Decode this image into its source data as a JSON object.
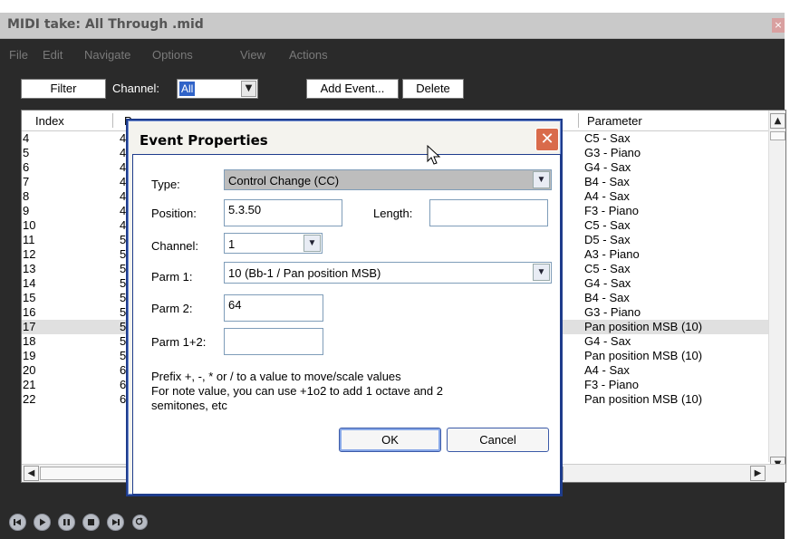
{
  "window": {
    "title": "MIDI take: All Through .mid",
    "close_glyph": "×"
  },
  "menu": [
    "File",
    "Edit",
    "Navigate",
    "Options",
    "View",
    "Actions"
  ],
  "toolbar": {
    "filter_label": "Filter",
    "channel_label": "Channel:",
    "channel_value": "All",
    "add_event_label": "Add Event...",
    "delete_label": "Delete"
  },
  "list": {
    "columns": {
      "index": "Index",
      "position_partial": "P",
      "parameter": "Parameter"
    },
    "rows": [
      {
        "index": "4",
        "pos": "4",
        "param": "C5 - Sax"
      },
      {
        "index": "5",
        "pos": "4",
        "param": "G3 - Piano"
      },
      {
        "index": "6",
        "pos": "4",
        "param": "G4 - Sax"
      },
      {
        "index": "7",
        "pos": "4",
        "param": "B4 - Sax"
      },
      {
        "index": "8",
        "pos": "4",
        "param": "A4 - Sax"
      },
      {
        "index": "9",
        "pos": "4",
        "param": "F3 - Piano"
      },
      {
        "index": "10",
        "pos": "4",
        "param": "C5 - Sax"
      },
      {
        "index": "11",
        "pos": "5",
        "param": "D5 - Sax"
      },
      {
        "index": "12",
        "pos": "5",
        "param": "A3 - Piano"
      },
      {
        "index": "13",
        "pos": "5",
        "param": "C5 - Sax"
      },
      {
        "index": "14",
        "pos": "5",
        "param": "G4 - Sax"
      },
      {
        "index": "15",
        "pos": "5",
        "param": "B4 - Sax"
      },
      {
        "index": "16",
        "pos": "5",
        "param": "G3 - Piano"
      },
      {
        "index": "17",
        "pos": "5",
        "param": "Pan position MSB (10)"
      },
      {
        "index": "18",
        "pos": "5",
        "param": "G4 - Sax"
      },
      {
        "index": "19",
        "pos": "5",
        "param": "Pan position MSB (10)"
      },
      {
        "index": "20",
        "pos": "6",
        "param": "A4 - Sax"
      },
      {
        "index": "21",
        "pos": "6",
        "param": "F3 - Piano"
      },
      {
        "index": "22",
        "pos": "6",
        "param": "Pan position MSB (10)"
      }
    ],
    "selected_index": "17"
  },
  "dialog": {
    "title": "Event Properties",
    "close_glyph": "✕",
    "type_label": "Type:",
    "type_value": "Control Change (CC)",
    "position_label": "Position:",
    "position_value": "5.3.50",
    "length_label": "Length:",
    "length_value": "",
    "channel_label": "Channel:",
    "channel_value": "1",
    "parm1_label": "Parm 1:",
    "parm1_value": "10 (Bb-1 / Pan position MSB)",
    "parm2_label": "Parm 2:",
    "parm2_value": "64",
    "parm12_label": "Parm 1+2:",
    "parm12_value": "",
    "hint_line1": "Prefix +, -, * or / to a value to move/scale values",
    "hint_line2": "For note value, you can use +1o2 to add 1 octave and 2",
    "hint_line3": "semitones, etc",
    "ok_label": "OK",
    "cancel_label": "Cancel"
  },
  "icons": {
    "dropdown": "chevron-down-icon",
    "scroll_up": "arrow-up-icon",
    "scroll_left": "arrow-left-icon",
    "scroll_right": "arrow-right-icon",
    "transport": [
      "rewind-icon",
      "play-icon",
      "pause-icon",
      "stop-icon",
      "forward-icon",
      "repeat-icon"
    ]
  },
  "colors": {
    "selection": "#3063c8",
    "dialog_frame": "#1e3c8c",
    "close_button": "#d96b4b"
  }
}
